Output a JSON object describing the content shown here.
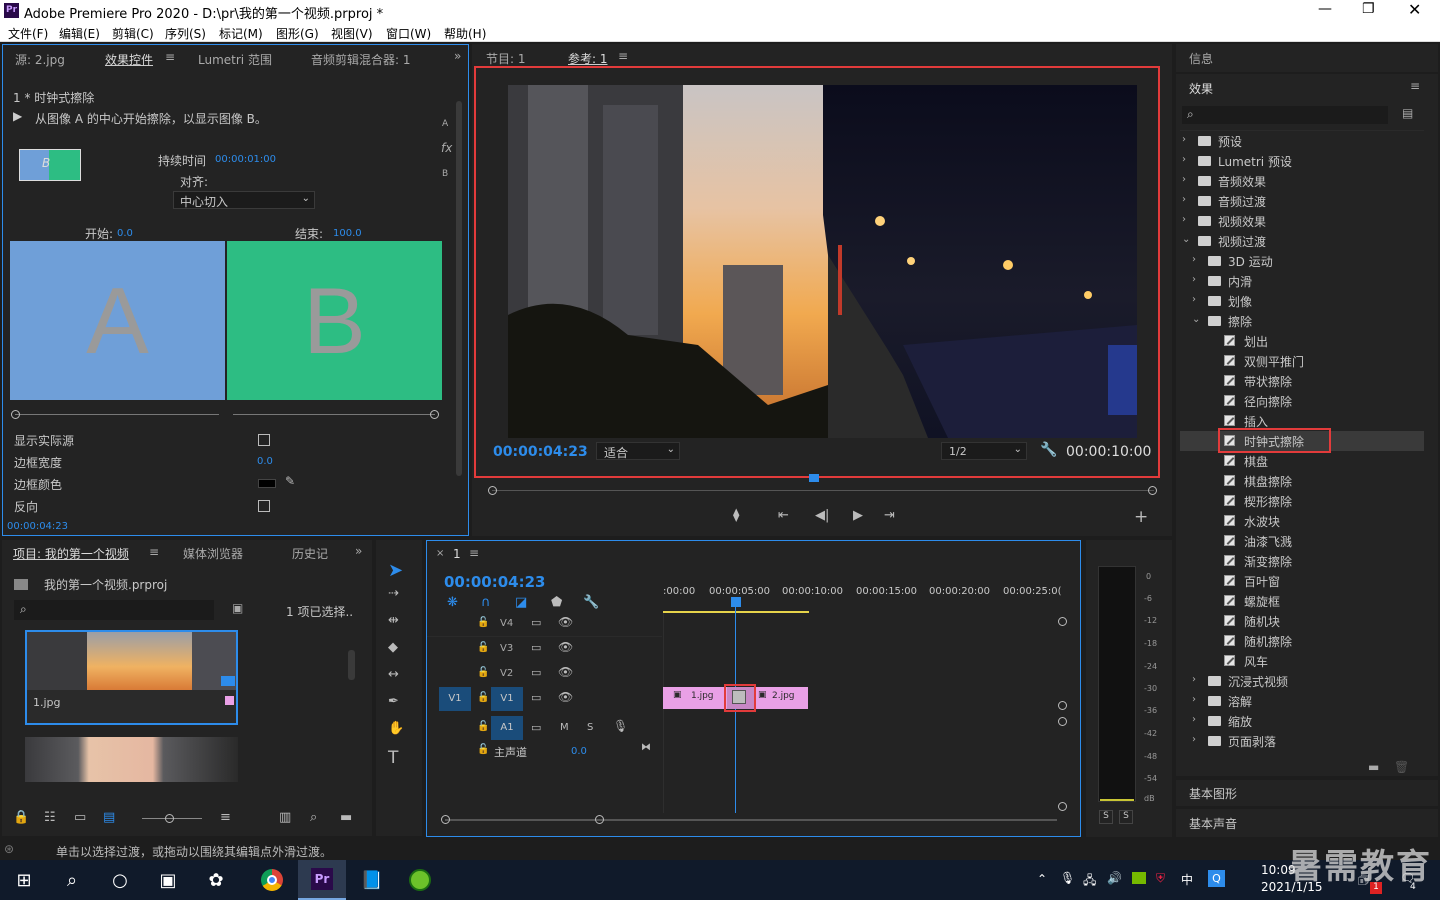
{
  "app": {
    "title": "Adobe Premiere Pro 2020 - D:\\pr\\我的第一个视频.prproj *",
    "icon": "Pr"
  },
  "menu": [
    "文件(F)",
    "编辑(E)",
    "剪辑(C)",
    "序列(S)",
    "标记(M)",
    "图形(G)",
    "视图(V)",
    "窗口(W)",
    "帮助(H)"
  ],
  "effect_controls": {
    "tabs": [
      "源: 2.jpg",
      "效果控件",
      "Lumetri 范围",
      "音频剪辑混合器: 1"
    ],
    "header": "1 * 时钟式擦除",
    "desc": "从图像 A 的中心开始擦除，以显示图像 B。",
    "duration_label": "持续时间",
    "duration_value": "00:00:01:00",
    "align_label": "对齐:",
    "align_value": "中心切入",
    "start_label": "开始:",
    "start_value": "0.0",
    "end_label": "结束:",
    "end_value": "100.0",
    "thumb_a": "A",
    "thumb_b": "B",
    "show_source": "显示实际源",
    "border_width": "边框宽度",
    "border_width_value": "0.0",
    "border_color": "边框颜色",
    "reverse": "反向",
    "timecode": "00:00:04:23",
    "side_a": "A",
    "side_b": "B",
    "fx": "fx",
    "preview_letter": "B"
  },
  "program": {
    "tabs": [
      "节目: 1",
      "参考: 1"
    ],
    "timecode": "00:00:04:23",
    "fit": "适合",
    "quality": "1/2",
    "duration": "00:00:10:00"
  },
  "project": {
    "tabs": [
      "项目: 我的第一个视频",
      "媒体浏览器",
      "历史记",
      "»"
    ],
    "file": "我的第一个视频.prproj",
    "selected": "1 项已选择..",
    "clip1": "1.jpg"
  },
  "timeline": {
    "tab": "1",
    "timecode": "00:00:04:23",
    "ruler": [
      ":00:00",
      "00:00:05:00",
      "00:00:10:00",
      "00:00:15:00",
      "00:00:20:00",
      "00:00:25:0("
    ],
    "tracks": [
      "V4",
      "V3",
      "V2",
      "V1"
    ],
    "v1_src": "V1",
    "audio": "A1",
    "master": "主声道",
    "master_value": "0.0",
    "m": "M",
    "s": "S",
    "clip1": "1.jpg",
    "clip2": "2.jpg"
  },
  "meter": {
    "scale": [
      "0",
      "-6",
      "-12",
      "-18",
      "-24",
      "-30",
      "-36",
      "-42",
      "-48",
      "-54",
      "dB"
    ],
    "s1": "S",
    "s2": "S"
  },
  "effects_panel": {
    "info_tab": "信息",
    "title": "效果",
    "items": [
      {
        "label": "预设",
        "indent": 0,
        "type": "folder",
        "arrow": "›"
      },
      {
        "label": "Lumetri 预设",
        "indent": 0,
        "type": "folder",
        "arrow": "›"
      },
      {
        "label": "音频效果",
        "indent": 0,
        "type": "folder",
        "arrow": "›"
      },
      {
        "label": "音频过渡",
        "indent": 0,
        "type": "folder",
        "arrow": "›"
      },
      {
        "label": "视频效果",
        "indent": 0,
        "type": "folder",
        "arrow": "›"
      },
      {
        "label": "视频过渡",
        "indent": 0,
        "type": "folder",
        "arrow": "⌄"
      },
      {
        "label": "3D 运动",
        "indent": 1,
        "type": "folder",
        "arrow": "›"
      },
      {
        "label": "内滑",
        "indent": 1,
        "type": "folder",
        "arrow": "›"
      },
      {
        "label": "划像",
        "indent": 1,
        "type": "folder",
        "arrow": "›"
      },
      {
        "label": "擦除",
        "indent": 1,
        "type": "folder",
        "arrow": "⌄"
      },
      {
        "label": "划出",
        "indent": 2,
        "type": "fx",
        "arrow": ""
      },
      {
        "label": "双侧平推门",
        "indent": 2,
        "type": "fx",
        "arrow": ""
      },
      {
        "label": "带状擦除",
        "indent": 2,
        "type": "fx",
        "arrow": ""
      },
      {
        "label": "径向擦除",
        "indent": 2,
        "type": "fx",
        "arrow": ""
      },
      {
        "label": "插入",
        "indent": 2,
        "type": "fx",
        "arrow": ""
      },
      {
        "label": "时钟式擦除",
        "indent": 2,
        "type": "fx",
        "arrow": "",
        "selected": true
      },
      {
        "label": "棋盘",
        "indent": 2,
        "type": "fx",
        "arrow": ""
      },
      {
        "label": "棋盘擦除",
        "indent": 2,
        "type": "fx",
        "arrow": ""
      },
      {
        "label": "楔形擦除",
        "indent": 2,
        "type": "fx",
        "arrow": ""
      },
      {
        "label": "水波块",
        "indent": 2,
        "type": "fx",
        "arrow": ""
      },
      {
        "label": "油漆飞溅",
        "indent": 2,
        "type": "fx",
        "arrow": ""
      },
      {
        "label": "渐变擦除",
        "indent": 2,
        "type": "fx",
        "arrow": ""
      },
      {
        "label": "百叶窗",
        "indent": 2,
        "type": "fx",
        "arrow": ""
      },
      {
        "label": "螺旋框",
        "indent": 2,
        "type": "fx",
        "arrow": ""
      },
      {
        "label": "随机块",
        "indent": 2,
        "type": "fx",
        "arrow": ""
      },
      {
        "label": "随机擦除",
        "indent": 2,
        "type": "fx",
        "arrow": ""
      },
      {
        "label": "风车",
        "indent": 2,
        "type": "fx",
        "arrow": ""
      },
      {
        "label": "沉浸式视频",
        "indent": 1,
        "type": "folder",
        "arrow": "›"
      },
      {
        "label": "溶解",
        "indent": 1,
        "type": "folder",
        "arrow": "›"
      },
      {
        "label": "缩放",
        "indent": 1,
        "type": "folder",
        "arrow": "›"
      },
      {
        "label": "页面剥落",
        "indent": 1,
        "type": "folder",
        "arrow": "›"
      }
    ],
    "basic_graphics": "基本图形",
    "basic_sound": "基本声音"
  },
  "status_bar": "单击以选择过渡，或拖动以围绕其编辑点外滑过渡。",
  "taskbar": {
    "time": "10:09",
    "date": "2021/1/15",
    "ime": "中",
    "badge": "4",
    "tray_badge": "1"
  },
  "watermark": "暑需教育",
  "colors": {
    "accent": "#2d8ceb",
    "highlight_red": "#e23b3b",
    "clip_pink": "#e9a0e6",
    "thumb_a": "#6f9fd8",
    "thumb_b": "#2dbd83"
  }
}
